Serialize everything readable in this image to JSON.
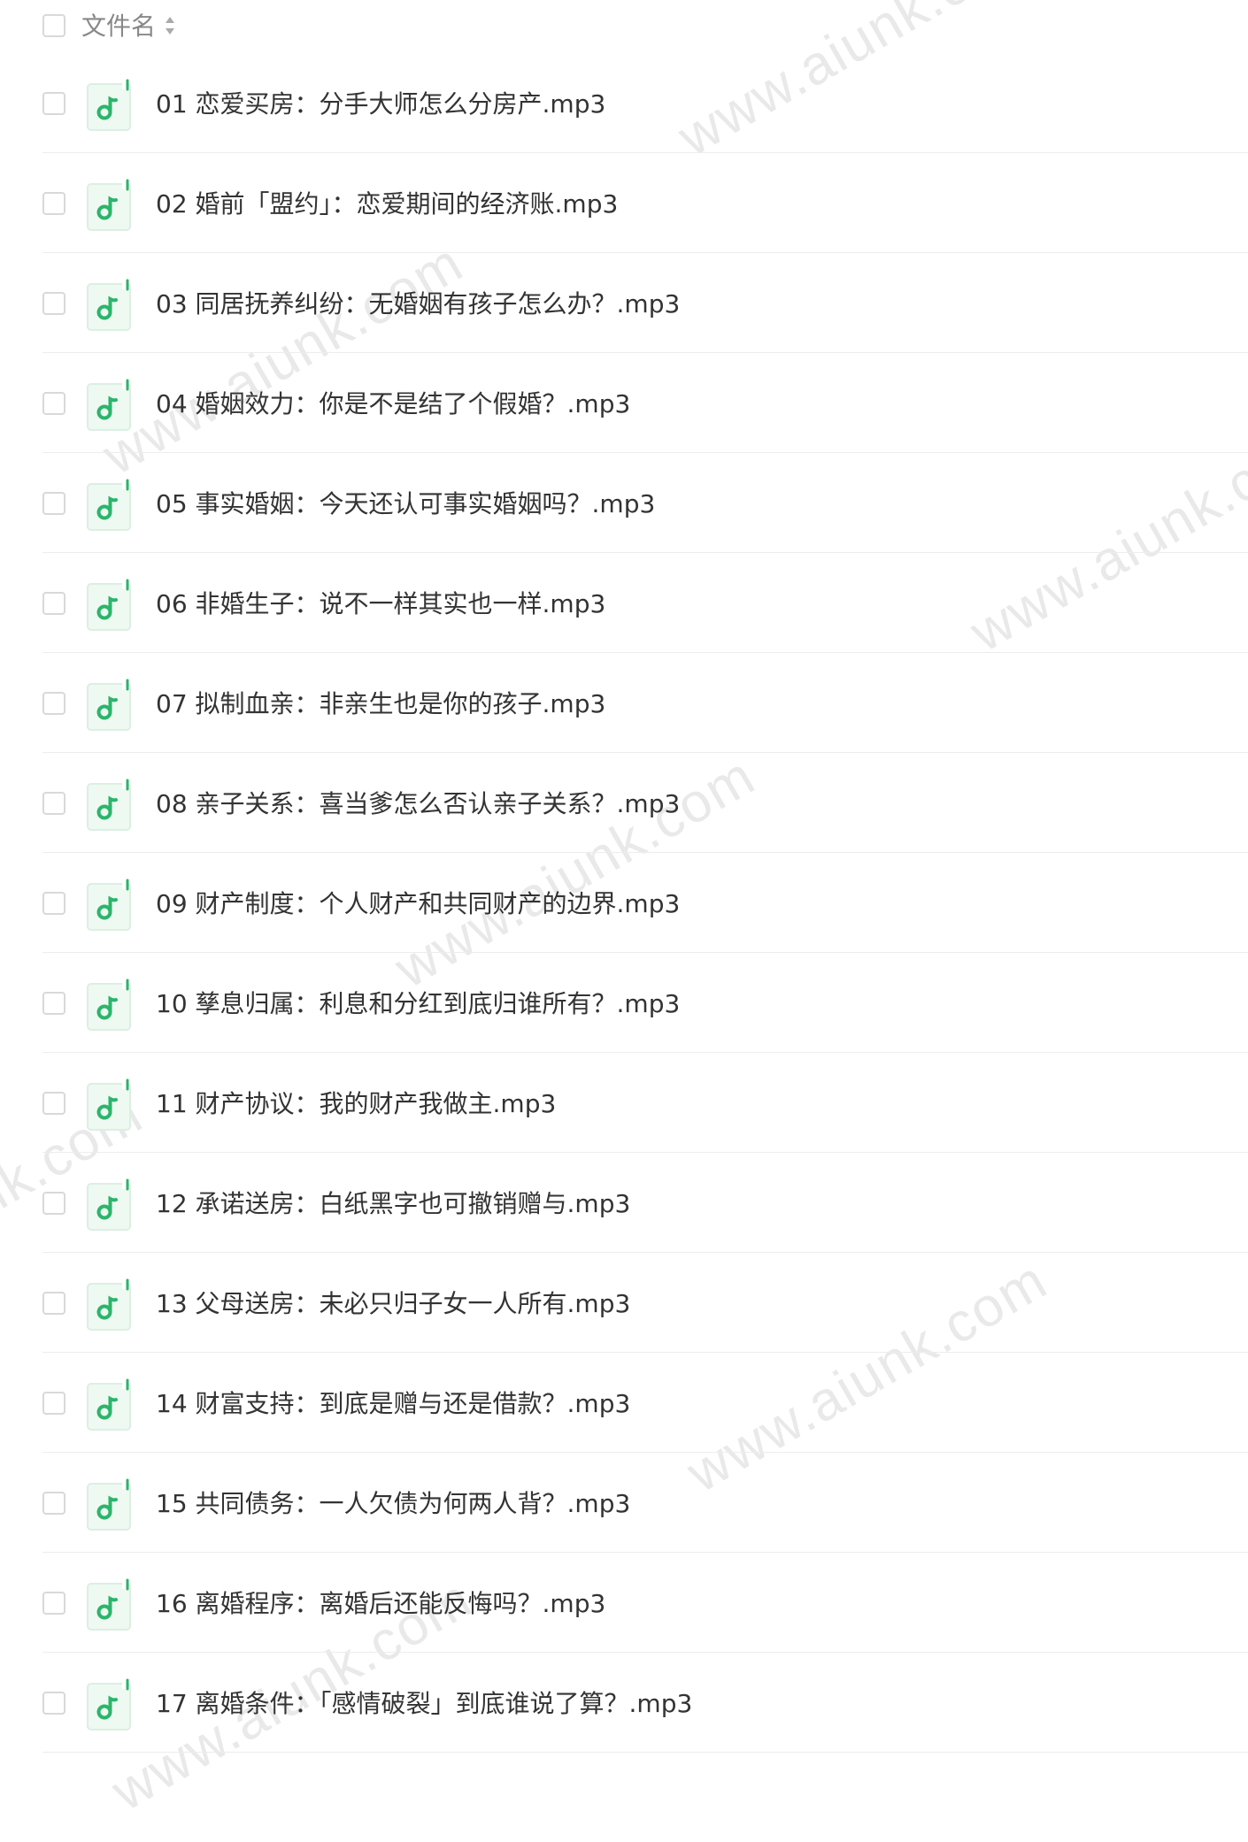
{
  "header": {
    "column_label": "文件名"
  },
  "icons": {
    "file_type": "music-note-icon",
    "sort": "sort-arrows-icon"
  },
  "colors": {
    "accent_green": "#2bb56a",
    "icon_bg": "#eef9f2"
  },
  "files": [
    {
      "name": "01 恋爱买房：分手大师怎么分房产.mp3"
    },
    {
      "name": "02 婚前「盟约」：恋爱期间的经济账.mp3"
    },
    {
      "name": "03 同居抚养纠纷：无婚姻有孩子怎么办？.mp3"
    },
    {
      "name": "04 婚姻效力：你是不是结了个假婚？.mp3"
    },
    {
      "name": "05 事实婚姻：今天还认可事实婚姻吗？.mp3"
    },
    {
      "name": "06 非婚生子：说不一样其实也一样.mp3"
    },
    {
      "name": "07 拟制血亲：非亲生也是你的孩子.mp3"
    },
    {
      "name": "08 亲子关系：喜当爹怎么否认亲子关系？.mp3"
    },
    {
      "name": "09 财产制度：个人财产和共同财产的边界.mp3"
    },
    {
      "name": "10 孳息归属：利息和分红到底归谁所有？.mp3"
    },
    {
      "name": "11 财产协议：我的财产我做主.mp3"
    },
    {
      "name": "12 承诺送房：白纸黑字也可撤销赠与.mp3"
    },
    {
      "name": "13 父母送房：未必只归子女一人所有.mp3"
    },
    {
      "name": "14 财富支持：到底是赠与还是借款？.mp3"
    },
    {
      "name": "15 共同债务：一人欠债为何两人背？.mp3"
    },
    {
      "name": "16 离婚程序：离婚后还能反悔吗？.mp3"
    },
    {
      "name": "17 离婚条件：「感情破裂」到底谁说了算？.mp3"
    }
  ],
  "watermarks": [
    "www.aiunk.com",
    "www.aiunk.com",
    "www.aiunk.com",
    "www.aiunk.com",
    "www.aiunk.com",
    "nk.com",
    "www.aiunk.com"
  ]
}
